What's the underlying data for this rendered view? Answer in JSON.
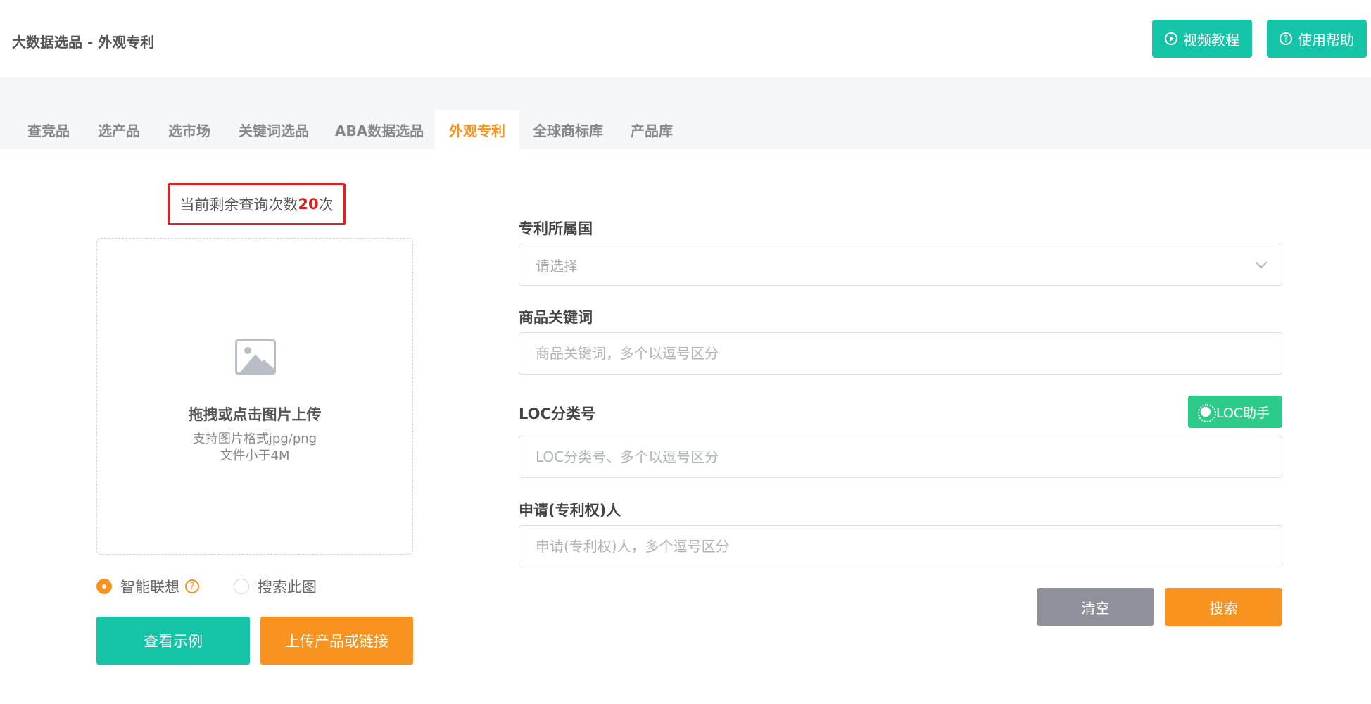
{
  "header": {
    "title": "大数据选品 - 外观专利",
    "video_label": "视频教程",
    "help_label": "使用帮助"
  },
  "tabs": [
    {
      "label": "查竞品",
      "active": false
    },
    {
      "label": "选产品",
      "active": false
    },
    {
      "label": "选市场",
      "active": false
    },
    {
      "label": "关键词选品",
      "active": false
    },
    {
      "label": "ABA数据选品",
      "active": false
    },
    {
      "label": "外观专利",
      "active": true
    },
    {
      "label": "全球商标库",
      "active": false
    },
    {
      "label": "产品库",
      "active": false
    }
  ],
  "quota": {
    "prefix": "当前剩余查询次数",
    "count": "20",
    "suffix": "次"
  },
  "upload": {
    "title": "拖拽或点击图片上传",
    "format_hint": "支持图片格式jpg/png",
    "size_hint": "文件小于4M"
  },
  "search_mode": {
    "option_smart": "智能联想",
    "option_image": "搜索此图",
    "selected": "智能联想"
  },
  "left_buttons": {
    "example_label": "查看示例",
    "upload_label": "上传产品或链接"
  },
  "form": {
    "country_label": "专利所属国",
    "country_placeholder": "请选择",
    "keyword_label": "商品关键词",
    "keyword_placeholder": "商品关键词，多个以逗号区分",
    "loc_label": "LOC分类号",
    "loc_helper_label": "LOC助手",
    "loc_placeholder": "LOC分类号、多个以逗号区分",
    "applicant_label": "申请(专利权)人",
    "applicant_placeholder": "申请(专利权)人，多个逗号区分",
    "clear_label": "清空",
    "search_label": "搜索"
  },
  "colors": {
    "accent_teal": "#14c4a6",
    "accent_orange": "#f7931e",
    "quota_red": "#e02020",
    "loc_green": "#2dcb8a",
    "clear_gray": "#8e9199"
  }
}
